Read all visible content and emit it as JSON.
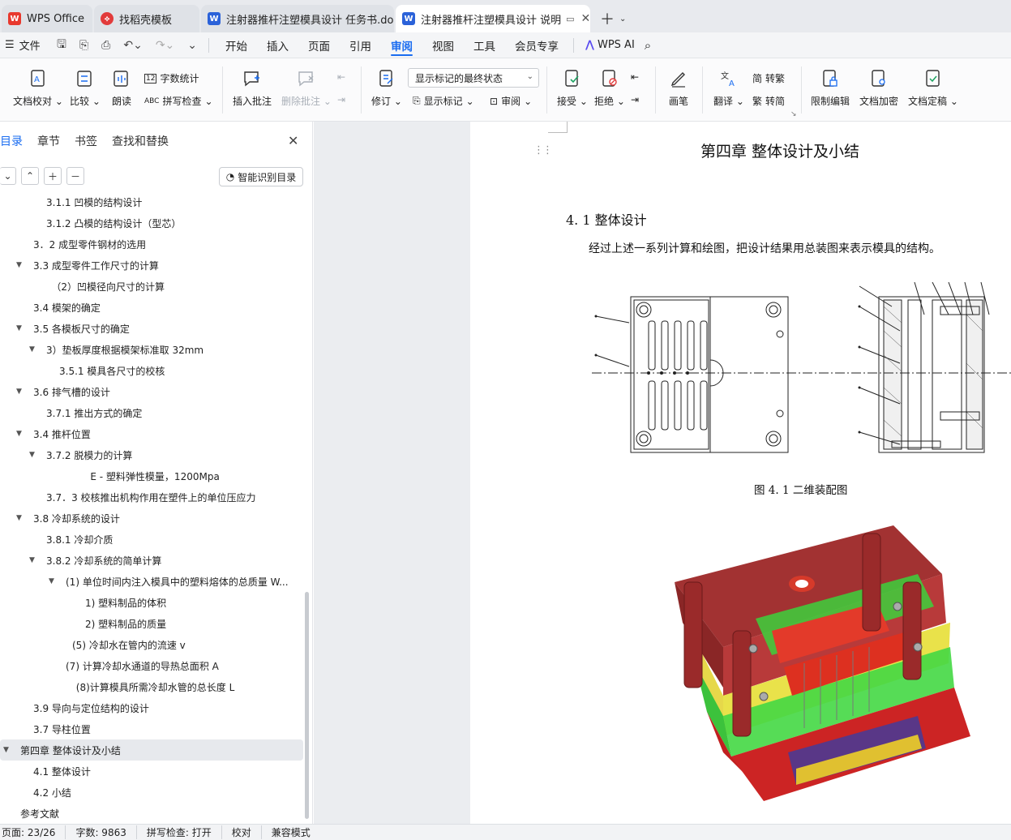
{
  "tabs": [
    {
      "label": "WPS Office",
      "logo": "wps-logo-icon",
      "active": false
    },
    {
      "label": "找稻壳模板",
      "logo": "docer-logo-icon",
      "active": false
    },
    {
      "label": "注射器推杆注塑模具设计 任务书.docx",
      "logo": "word-doc-icon",
      "active": false
    },
    {
      "label": "注射器推杆注塑模具设计 说明",
      "logo": "word-doc-icon",
      "active": true
    }
  ],
  "menubar": {
    "file": "文件",
    "items": [
      "开始",
      "插入",
      "页面",
      "引用",
      "审阅",
      "视图",
      "工具",
      "会员专享"
    ],
    "active": "审阅",
    "wps_ai": "WPS AI"
  },
  "ribbon": {
    "doc_check": "文档校对",
    "compare": "比较",
    "read_aloud": "朗读",
    "word_count": "字数统计",
    "spell_check": "拼写检查",
    "insert_comment": "插入批注",
    "delete_comment": "删除批注",
    "revise": "修订",
    "markup_state": "显示标记的最终状态",
    "show_markup": "显示标记",
    "review": "审阅",
    "accept": "接受",
    "reject": "拒绝",
    "pen": "画笔",
    "translate": "翻译",
    "to_traditional": "转繁",
    "to_simplified": "转简",
    "restrict_edit": "限制编辑",
    "encrypt": "文档加密",
    "finalize": "文档定稿"
  },
  "nav": {
    "tabs": [
      "目录",
      "章节",
      "书签",
      "查找和替换"
    ],
    "active_tab": "目录",
    "smart_button": "智能识别目录",
    "items": [
      {
        "text": "3.1.1 凹模的结构设计",
        "indent": 3,
        "toggle": ""
      },
      {
        "text": "3.1.2 凸模的结构设计（型芯）",
        "indent": 3,
        "toggle": ""
      },
      {
        "text": "3．2 成型零件钢材的选用",
        "indent": 2,
        "toggle": ""
      },
      {
        "text": "3.3 成型零件工作尺寸的计算",
        "indent": 2,
        "toggle": "▼"
      },
      {
        "text": "（2）凹模径向尺寸的计算",
        "indent": 3.4,
        "toggle": ""
      },
      {
        "text": "3.4 模架的确定",
        "indent": 2,
        "toggle": ""
      },
      {
        "text": "3.5 各模板尺寸的确定",
        "indent": 2,
        "toggle": "▼"
      },
      {
        "text": "3）垫板厚度根据模架标准取 32mm",
        "indent": 3,
        "toggle": "▼"
      },
      {
        "text": "3.5.1 模具各尺寸的校核",
        "indent": 4,
        "toggle": ""
      },
      {
        "text": "3.6 排气槽的设计",
        "indent": 2,
        "toggle": "▼"
      },
      {
        "text": "3.7.1 推出方式的确定",
        "indent": 3,
        "toggle": ""
      },
      {
        "text": "3.4 推杆位置",
        "indent": 2,
        "toggle": "▼"
      },
      {
        "text": "3.7.2 脱模力的计算",
        "indent": 3,
        "toggle": "▼"
      },
      {
        "text": "E - 塑料弹性模量，1200Mpa",
        "indent": 6.4,
        "toggle": ""
      },
      {
        "text": "3.7．3 校核推出机构作用在塑件上的单位压应力",
        "indent": 3,
        "toggle": ""
      },
      {
        "text": "3.8  冷却系统的设计",
        "indent": 2,
        "toggle": "▼"
      },
      {
        "text": "3.8.1 冷却介质",
        "indent": 3,
        "toggle": ""
      },
      {
        "text": "3.8.2 冷却系统的简单计算",
        "indent": 3,
        "toggle": "▼"
      },
      {
        "text": "(1)    单位时间内注入模具中的塑料熔体的总质量 W...",
        "indent": 4.5,
        "toggle": "▼"
      },
      {
        "text": "1)      塑料制品的体积",
        "indent": 6,
        "toggle": ""
      },
      {
        "text": "2)      塑料制品的质量",
        "indent": 6,
        "toggle": ""
      },
      {
        "text": "(5)      冷却水在管内的流速 v",
        "indent": 5,
        "toggle": ""
      },
      {
        "text": "(7)   计算冷却水通道的导热总面积 A",
        "indent": 4.5,
        "toggle": ""
      },
      {
        "text": "(8)计算模具所需冷却水管的总长度 L",
        "indent": 5.3,
        "toggle": ""
      },
      {
        "text": "3.9 导向与定位结构的设计",
        "indent": 2,
        "toggle": ""
      },
      {
        "text": "3.7 导柱位置",
        "indent": 2,
        "toggle": ""
      },
      {
        "text": "第四章  整体设计及小结",
        "indent": 1,
        "toggle": "▼",
        "selected": true
      },
      {
        "text": "4.1 整体设计",
        "indent": 2,
        "toggle": ""
      },
      {
        "text": "4.2 小结",
        "indent": 2,
        "toggle": ""
      },
      {
        "text": "参考文献",
        "indent": 1,
        "toggle": ""
      }
    ]
  },
  "document": {
    "chapter_title": "第四章  整体设计及小结",
    "section_title": "4. 1 整体设计",
    "paragraph": "经过上述一系列计算和绘图，把设计结果用总装图来表示模具的结构。",
    "figure_caption": "图 4. 1 二维装配图"
  },
  "status": {
    "page": "页面: 23/26",
    "words": "字数: 9863",
    "spell": "拼写检查: 打开",
    "proof": "校对",
    "compat": "兼容模式"
  },
  "colors": {
    "accent": "#1a6cf0",
    "wps_red": "#e8392e",
    "word_blue": "#2b62d9",
    "docer_red": "#e23b3b"
  }
}
